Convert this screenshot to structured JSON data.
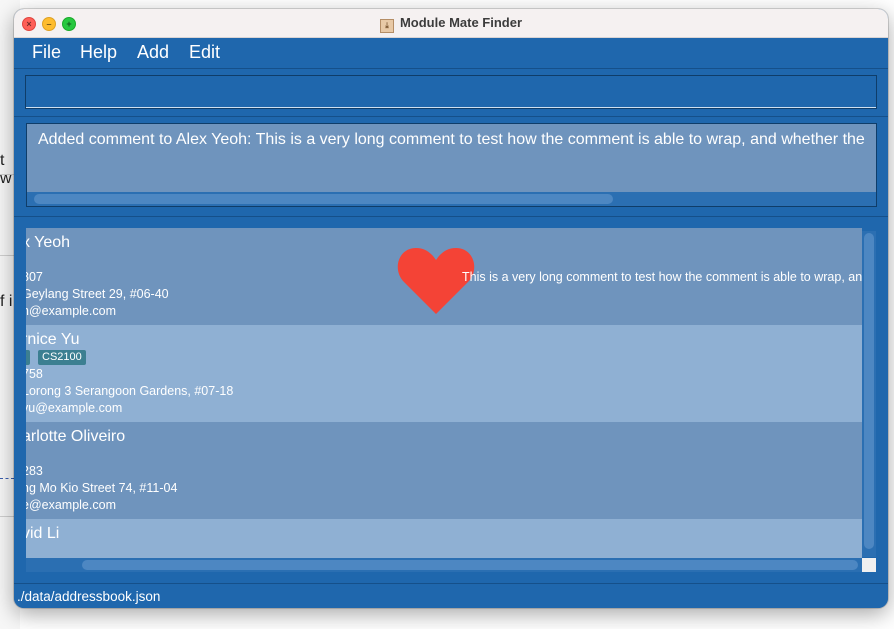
{
  "window": {
    "title": "Module Mate Finder"
  },
  "background_fragments": [
    "t w",
    "f i"
  ],
  "menu": [
    "File",
    "Help",
    "Add",
    "Edit"
  ],
  "command": {
    "value": ""
  },
  "result": {
    "text": "Added comment to Alex Yeoh: This is a very long comment to test how the comment is able to wrap, and whether the"
  },
  "persons": [
    {
      "name": "x Yeoh",
      "tags": [],
      "phone": "807",
      "address": "Geylang Street 29, #06-40",
      "email": "h@example.com",
      "comment": "This is a very long comment to test how the comment is able to wrap, an...",
      "favourite": true
    },
    {
      "name": "rnice Yu",
      "tags": [
        "0",
        "CS2100"
      ],
      "phone": "758",
      "address": "Lorong 3 Serangoon Gardens, #07-18",
      "email": "yu@example.com",
      "comment": "",
      "favourite": false
    },
    {
      "name": "arlotte Oliveiro",
      "tags": [],
      "phone": "283",
      "address": "ng Mo Kio Street 74, #11-04",
      "email": "e@example.com",
      "comment": "",
      "favourite": false
    },
    {
      "name": "vid Li",
      "tags": [],
      "phone": "",
      "address": "",
      "email": "",
      "comment": "",
      "favourite": false
    }
  ],
  "status": {
    "path": "./data/addressbook.json"
  },
  "colors": {
    "window_bg": "#1f67ad",
    "card_dark": "#6f94bd",
    "card_light": "#8fb0d3",
    "tag": "#3c7f91",
    "heart": "#f44336"
  },
  "icons": [
    "close-icon",
    "minimize-icon",
    "maximize-icon",
    "app-icon",
    "heart-icon"
  ]
}
